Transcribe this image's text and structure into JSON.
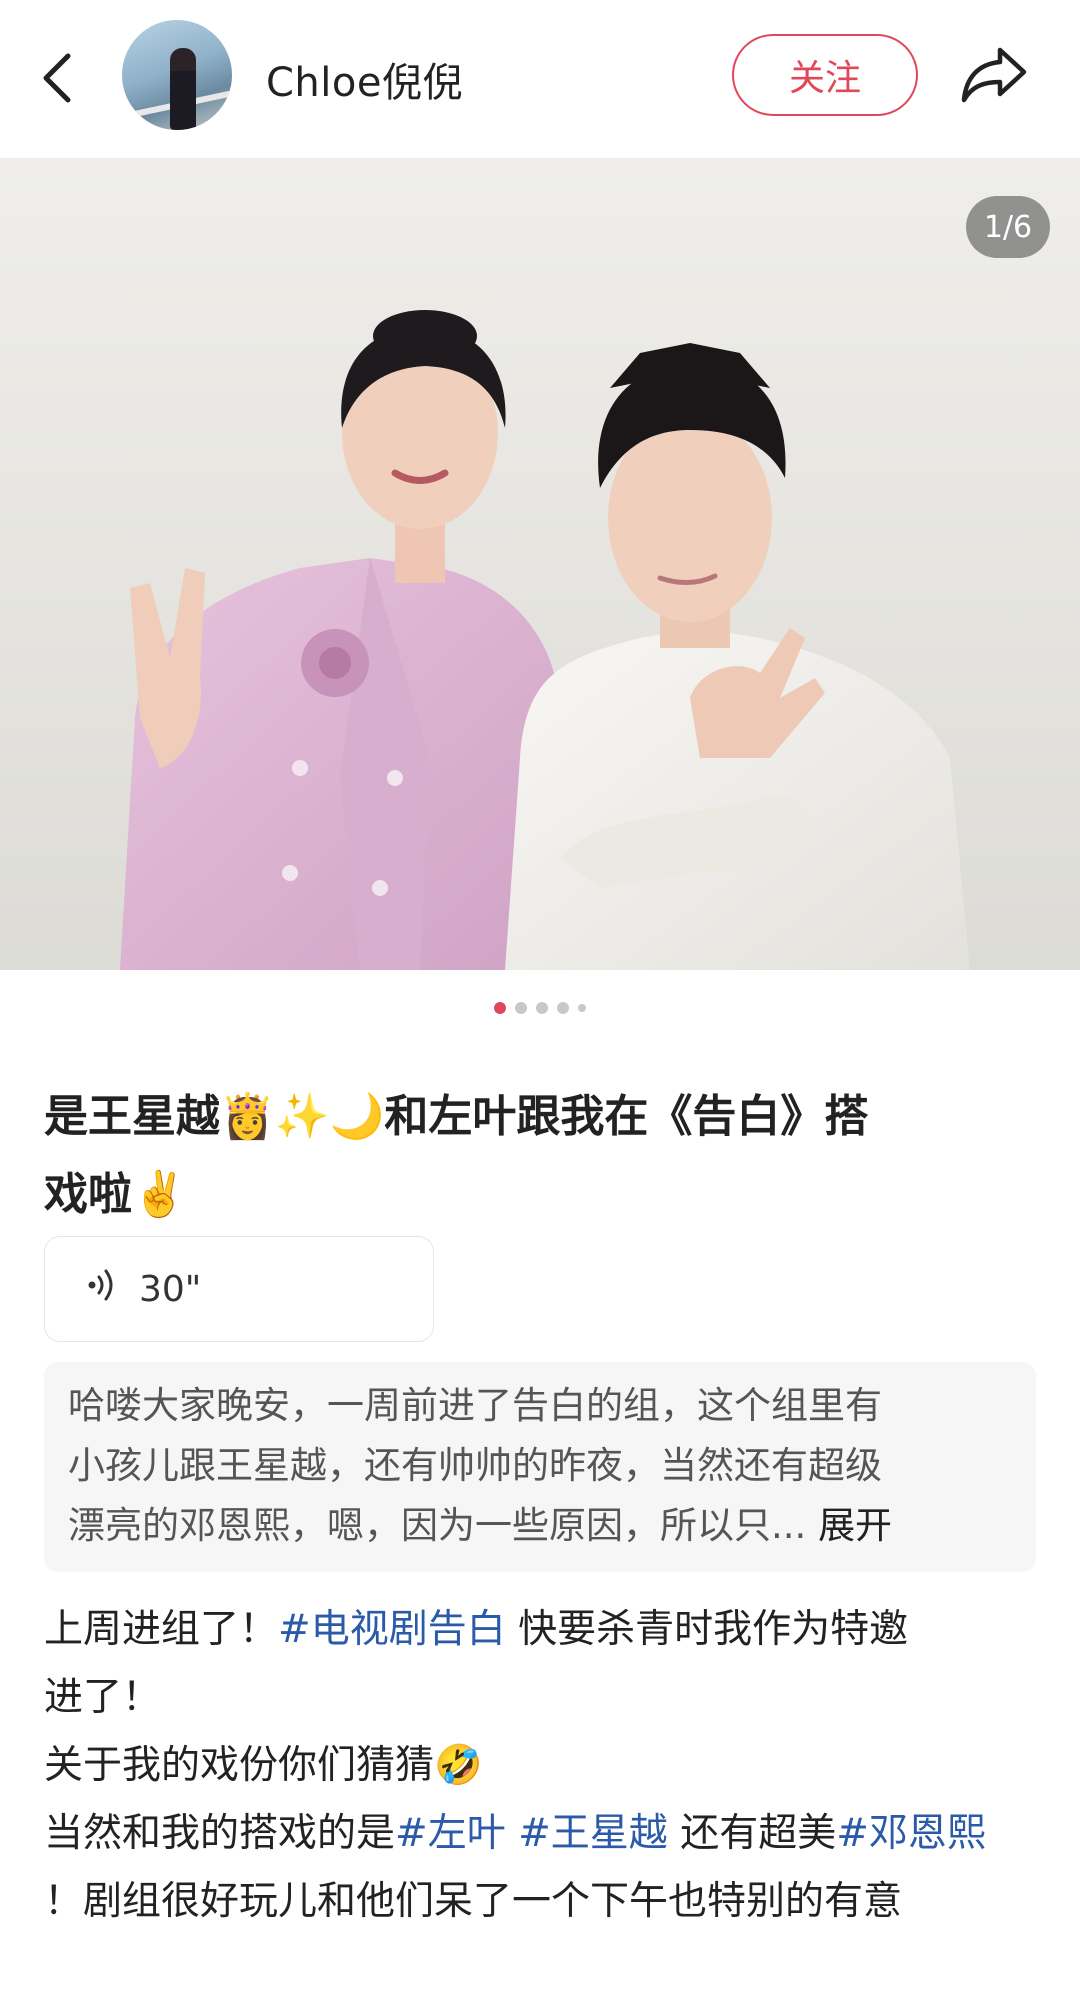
{
  "header": {
    "username": "Chloe倪倪",
    "follow_label": "关注"
  },
  "photo": {
    "counter": "1/6",
    "dot_count": 5,
    "active_dot": 0
  },
  "post": {
    "title_a": "是王星越",
    "emoji_crown": "👸",
    "emoji_sparkle": "✨",
    "emoji_moon": "🌙",
    "title_b": "和左叶跟我在《告白》搭",
    "title_c": "戏啦",
    "emoji_victory": "✌️",
    "voice_duration": "30\"",
    "summary_line1": "哈喽大家晚安，一周前进了告白的组，这个组里有",
    "summary_line2": "小孩儿跟王星越，还有帅帅的昨夜，当然还有超级",
    "summary_line3": "漂亮的邓恩熙，嗯，因为一些原因，所以只...",
    "summary_more": "展开",
    "body_1a": "上周进组了！",
    "tag_tv": "#电视剧告白",
    "body_1b": " 快要杀青时我作为特邀",
    "body_1c": "进了！",
    "body_2": "关于我的戏份你们猜猜",
    "emoji_laugh": "🤣",
    "body_3a": "当然和我的搭戏的是",
    "tag_zuoye": "#左叶",
    "tag_wangxingyue": "#王星越",
    "body_3b": " 还有超美",
    "tag_dengenxi": "#邓恩熙",
    "body_4": "！剧组很好玩儿和他们呆了一个下午也特别的有意"
  },
  "colors": {
    "accent": "#e0485a",
    "hashtag": "#2a5aa8"
  }
}
